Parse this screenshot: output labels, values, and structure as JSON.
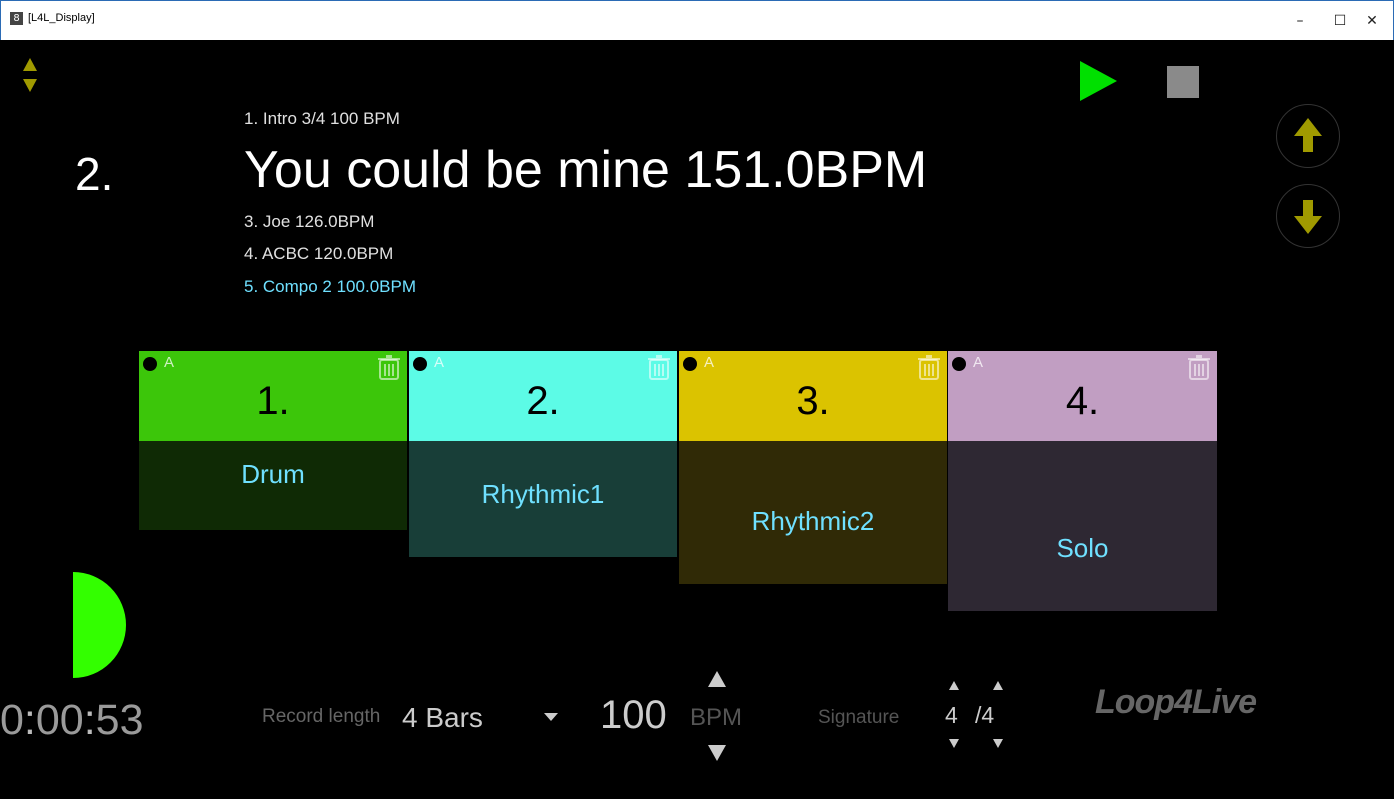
{
  "window": {
    "title": "[L4L_Display]",
    "app_icon": "8",
    "minimize": "–",
    "maximize": "☐",
    "close": "✕"
  },
  "setlist": {
    "previous": "1. Intro 3/4 100 BPM",
    "current_number": "2.",
    "current_title": "You could be mine 151.0BPM",
    "next": [
      "3. Joe 126.0BPM",
      "4. ACBC 120.0BPM",
      "5. Compo 2 100.0BPM"
    ],
    "highlight_color": "#6fe0ff"
  },
  "transport": {
    "play_icon": "play-icon",
    "stop_icon": "stop-icon",
    "play_color": "#00e000",
    "stop_color": "#8a8a8a"
  },
  "tracks": [
    {
      "number": "1.",
      "flag": "A",
      "name": "Drum",
      "head_color": "#3cc60a",
      "body_color": "#0f2a05",
      "level": 1.0
    },
    {
      "number": "2.",
      "flag": "A",
      "name": "Rhythmic1",
      "head_color": "#5cfbe6",
      "body_color": "#183e38",
      "level": 1.0
    },
    {
      "number": "3.",
      "flag": "A",
      "name": "Rhythmic2",
      "head_color": "#dbc300",
      "body_color": "#302a06",
      "level": 1.0
    },
    {
      "number": "4.",
      "flag": "A",
      "name": "Solo",
      "head_color": "#c19ec2",
      "body_color": "#2e2833",
      "level": 1.0
    }
  ],
  "footer": {
    "timer_h": "0",
    "timer_m": "00",
    "timer_s": "53",
    "record_length_label": "Record length",
    "record_length_value": "4 Bars",
    "tempo_value": "100",
    "tempo_unit": "BPM",
    "signature_label": "Signature",
    "signature_num": "4",
    "signature_den": "/4",
    "logo_text": "Loop4Live"
  },
  "colors": {
    "accent_olive": "#a09a00",
    "metronome_green": "#33ff00"
  }
}
